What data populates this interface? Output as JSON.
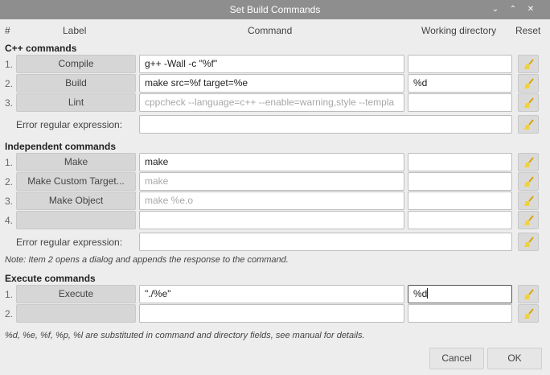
{
  "window": {
    "title": "Set Build Commands",
    "controls": [
      "⌄",
      "⌃",
      "✕"
    ]
  },
  "header": {
    "num": "#",
    "label": "Label",
    "command": "Command",
    "workdir": "Working directory",
    "reset": "Reset"
  },
  "cpp": {
    "title": "C++ commands",
    "rows": [
      {
        "num": "1.",
        "label": "Compile",
        "command": "g++ -Wall -c \"%f\"",
        "command_placeholder": "",
        "workdir": ""
      },
      {
        "num": "2.",
        "label": "Build",
        "command": "make src=%f target=%e",
        "command_placeholder": "",
        "workdir": "%d"
      },
      {
        "num": "3.",
        "label": "Lint",
        "command": "",
        "command_placeholder": "cppcheck --language=c++ --enable=warning,style --templa",
        "workdir": ""
      }
    ],
    "error_label": "Error regular expression:",
    "error_value": ""
  },
  "independent": {
    "title": "Independent commands",
    "rows": [
      {
        "num": "1.",
        "label": "Make",
        "command": "make",
        "command_placeholder": "",
        "workdir": ""
      },
      {
        "num": "2.",
        "label": "Make Custom Target...",
        "command": "",
        "command_placeholder": "make",
        "workdir": ""
      },
      {
        "num": "3.",
        "label": "Make Object",
        "command": "",
        "command_placeholder": "make %e.o",
        "workdir": ""
      },
      {
        "num": "4.",
        "label": "",
        "command": "",
        "command_placeholder": "",
        "workdir": ""
      }
    ],
    "error_label": "Error regular expression:",
    "error_value": "",
    "note": "Note: Item 2 opens a dialog and appends the response to the command."
  },
  "execute": {
    "title": "Execute commands",
    "rows": [
      {
        "num": "1.",
        "label": "Execute",
        "command": "\"./%e\"",
        "command_placeholder": "",
        "workdir": "%d"
      },
      {
        "num": "2.",
        "label": "",
        "command": "",
        "command_placeholder": "",
        "workdir": ""
      }
    ]
  },
  "footer_note": "%d, %e, %f, %p, %l are substituted in command and directory fields, see manual for details.",
  "buttons": {
    "cancel": "Cancel",
    "ok": "OK"
  },
  "colors": {
    "titlebar": "#8e8e8e",
    "broom_handle": "#d9a400",
    "broom_bristles": "#f2d23c"
  },
  "icons": {
    "reset": "broom-icon"
  }
}
